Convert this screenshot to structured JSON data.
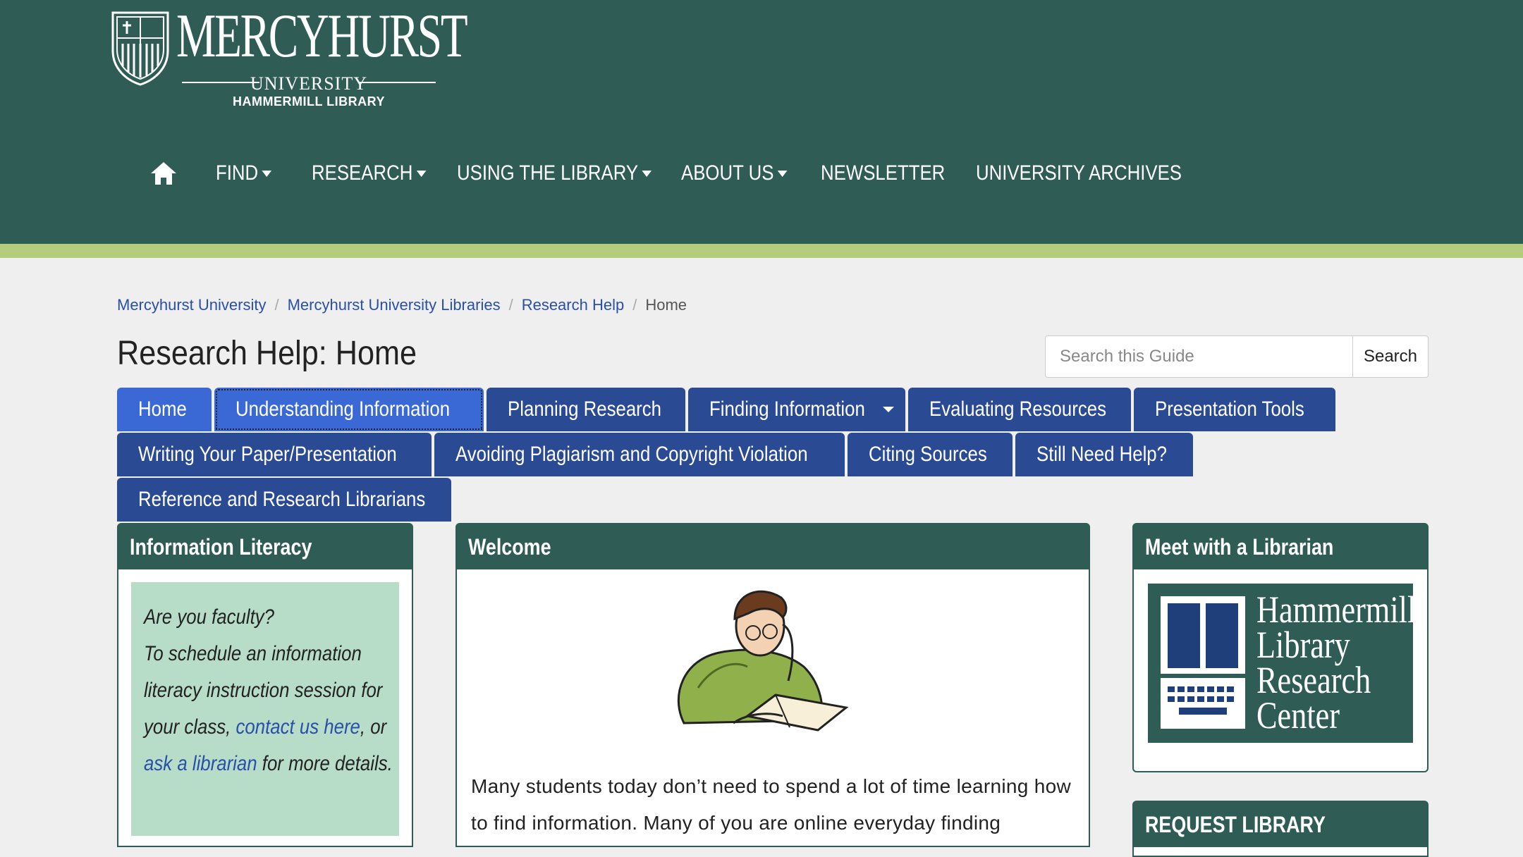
{
  "header": {
    "logo": {
      "name": "MERCYHURST",
      "university": "UNIVERSITY",
      "library": "HAMMERMILL LIBRARY"
    },
    "nav": [
      {
        "label": "FIND",
        "dropdown": true
      },
      {
        "label": "RESEARCH",
        "dropdown": true
      },
      {
        "label": "USING THE LIBRARY",
        "dropdown": true
      },
      {
        "label": "ABOUT US",
        "dropdown": true
      },
      {
        "label": "NEWSLETTER",
        "dropdown": false
      },
      {
        "label": "UNIVERSITY ARCHIVES",
        "dropdown": false
      }
    ]
  },
  "breadcrumb": [
    "Mercyhurst University",
    "Mercyhurst University Libraries",
    "Research Help",
    "Home"
  ],
  "page_title": "Research Help: Home",
  "search": {
    "placeholder": "Search this Guide",
    "button": "Search"
  },
  "tabs": [
    "Home",
    "Understanding Information",
    "Planning Research",
    "Finding Information",
    "Evaluating Resources",
    "Presentation Tools",
    "Writing Your Paper/Presentation",
    "Avoiding Plagiarism and Copyright Violation",
    "Citing Sources",
    "Still Need Help?",
    "Reference and Research Librarians"
  ],
  "boxes": {
    "info_literacy": {
      "title": "Information Literacy",
      "line1": "Are you faculty?",
      "line2": "To schedule an information literacy instruction session for your class,",
      "link1": "contact us here",
      "mid": ", or",
      "link2": "ask a librarian",
      "end": "for more details."
    },
    "welcome": {
      "title": "Welcome",
      "text": "Many students today don’t need to spend a lot of time learning how to find information. Many of you are online everyday finding"
    },
    "librarian": {
      "title": "Meet with a Librarian",
      "logo_lines": [
        "Hammermill",
        "Library",
        "Research",
        "Center"
      ]
    },
    "request": {
      "title": "REQUEST LIBRARY"
    }
  },
  "colors": {
    "header": "#2f5d56",
    "stripe": "#b3cd7c",
    "tab": "#2b4a94",
    "tab_active": "#3a68d4",
    "link": "#2a4fa8"
  }
}
